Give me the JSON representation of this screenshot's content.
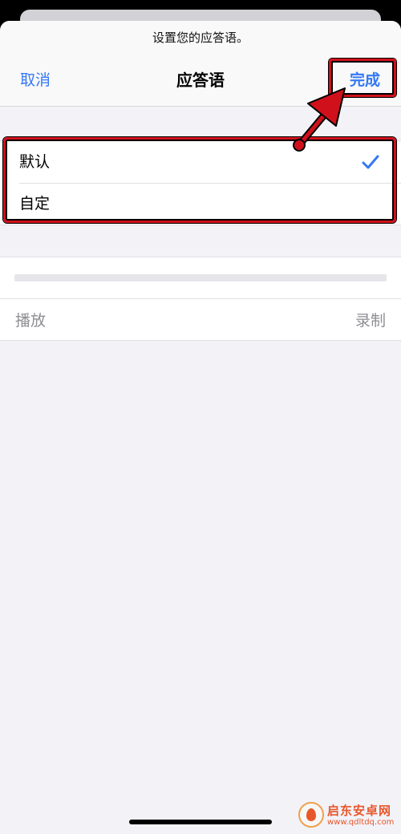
{
  "sheet": {
    "prompt": "设置您的应答语。",
    "title": "应答语",
    "cancel_label": "取消",
    "done_label": "完成"
  },
  "options": [
    {
      "label": "默认",
      "selected": true
    },
    {
      "label": "自定"
    }
  ],
  "recording": {
    "progress": 0,
    "play_label": "播放",
    "record_label": "录制"
  },
  "watermark": {
    "name": "启东安卓网",
    "url": "www.qdltdq.com"
  },
  "colors": {
    "accent": "#3478f6",
    "annotation": "#d0111b",
    "disabled_text": "#8e8e93"
  },
  "icons": {
    "checkmark": "checkmark-icon"
  }
}
